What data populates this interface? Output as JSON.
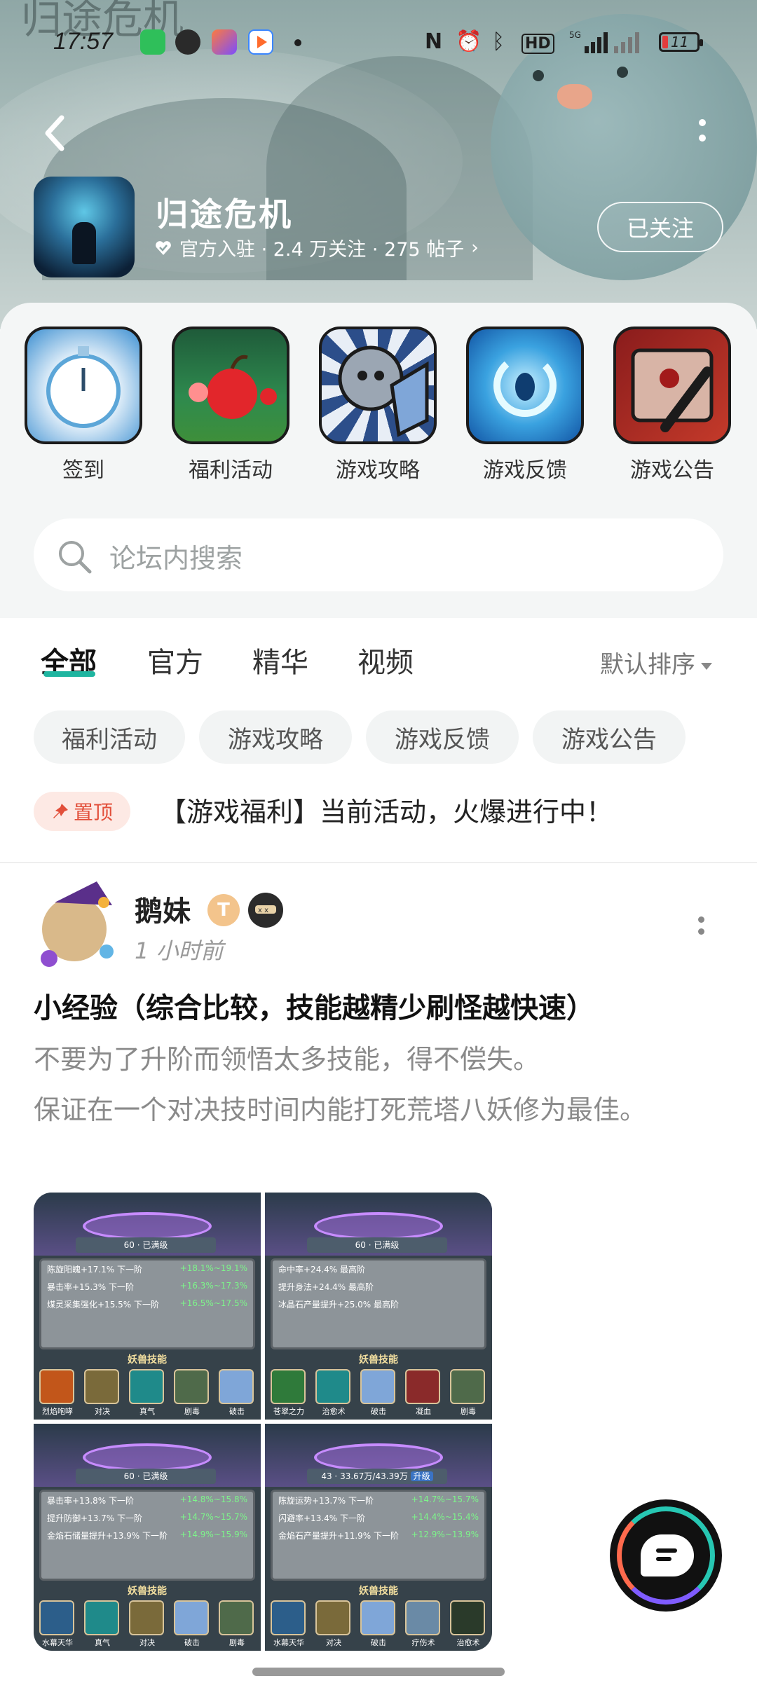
{
  "status_bar": {
    "time": "17:57",
    "battery": "11",
    "icons": [
      "nfc-icon",
      "alarm-icon",
      "bluetooth-icon",
      "hd-icon",
      "5g-signal-icon",
      "signal-icon"
    ]
  },
  "header": {
    "banner_calligraphy": "归途危机",
    "game_title": "归途危机",
    "meta": "官方入驻 · 2.4 万关注 · 275 帖子",
    "follow_label": "已关注"
  },
  "quick_links": [
    {
      "label": "签到",
      "icon": "stopwatch-icon"
    },
    {
      "label": "福利活动",
      "icon": "apple-icon"
    },
    {
      "label": "游戏攻略",
      "icon": "knight-icon"
    },
    {
      "label": "游戏反馈",
      "icon": "portal-icon"
    },
    {
      "label": "游戏公告",
      "icon": "scroll-icon"
    }
  ],
  "search": {
    "placeholder": "论坛内搜索"
  },
  "tabs": [
    {
      "label": "全部",
      "active": true
    },
    {
      "label": "官方"
    },
    {
      "label": "精华"
    },
    {
      "label": "视频"
    }
  ],
  "sort_label": "默认排序",
  "chips": [
    "福利活动",
    "游戏攻略",
    "游戏反馈",
    "游戏公告"
  ],
  "pinned": {
    "badge": "置顶",
    "title": "【游戏福利】当前活动，火爆进行中！"
  },
  "post": {
    "author": "鹅妹",
    "badge_text": "T",
    "time": "1 小时前",
    "title": "小经验（综合比较，技能越精少刷怪越快速）",
    "body_line1": "不要为了升阶而领悟太多技能，得不偿失。",
    "body_line2": "保证在一个对决技时间内能打死荒塔八妖修为最佳。",
    "images": [
      {
        "level": "60",
        "bar": "已满级",
        "stats": [
          [
            "陈旋阳魄+17.1%",
            "下一阶",
            "+18.1%~19.1%"
          ],
          [
            "暴击率+15.3%",
            "下一阶",
            "+16.3%~17.3%"
          ],
          [
            "煤灵采集强化+15.5%",
            "下一阶",
            "+16.5%~17.5%"
          ]
        ],
        "skills_title": "妖兽技能",
        "skills": [
          "烈焰咆哮",
          "对决",
          "真气",
          "剧毒",
          "破击"
        ]
      },
      {
        "level": "60",
        "bar": "已满级",
        "stats": [
          [
            "命中率+24.4%",
            "最高阶",
            ""
          ],
          [
            "提升身法+24.4%",
            "最高阶",
            ""
          ],
          [
            "冰晶石产量提升+25.0%",
            "最高阶",
            ""
          ]
        ],
        "skills_title": "妖兽技能",
        "skills": [
          "苍翠之力",
          "治愈术",
          "破击",
          "凝血",
          "剧毒"
        ]
      },
      {
        "level": "60",
        "bar": "已满级",
        "stats": [
          [
            "暴击率+13.8%",
            "下一阶",
            "+14.8%~15.8%"
          ],
          [
            "提升防御+13.7%",
            "下一阶",
            "+14.7%~15.7%"
          ],
          [
            "金焰石储量提升+13.9%",
            "下一阶",
            "+14.9%~15.9%"
          ]
        ],
        "skills_title": "妖兽技能",
        "skills": [
          "水幕天华",
          "真气",
          "对决",
          "破击",
          "剧毒"
        ]
      },
      {
        "level": "43",
        "bar": "33.67万/43.39万",
        "upgrade": "升级",
        "stats": [
          [
            "陈旋运势+13.7%",
            "下一阶",
            "+14.7%~15.7%"
          ],
          [
            "闪避率+13.4%",
            "下一阶",
            "+14.4%~15.4%"
          ],
          [
            "金焰石产量提升+11.9%",
            "下一阶",
            "+12.9%~13.9%"
          ]
        ],
        "skills_title": "妖兽技能",
        "skills": [
          "水幕天华",
          "对决",
          "破击",
          "疗伤术",
          "治愈术"
        ]
      }
    ]
  },
  "colors": {
    "accent": "#1fb5a0",
    "pin": "#e24f3a",
    "pin_bg": "#fde9e4"
  }
}
